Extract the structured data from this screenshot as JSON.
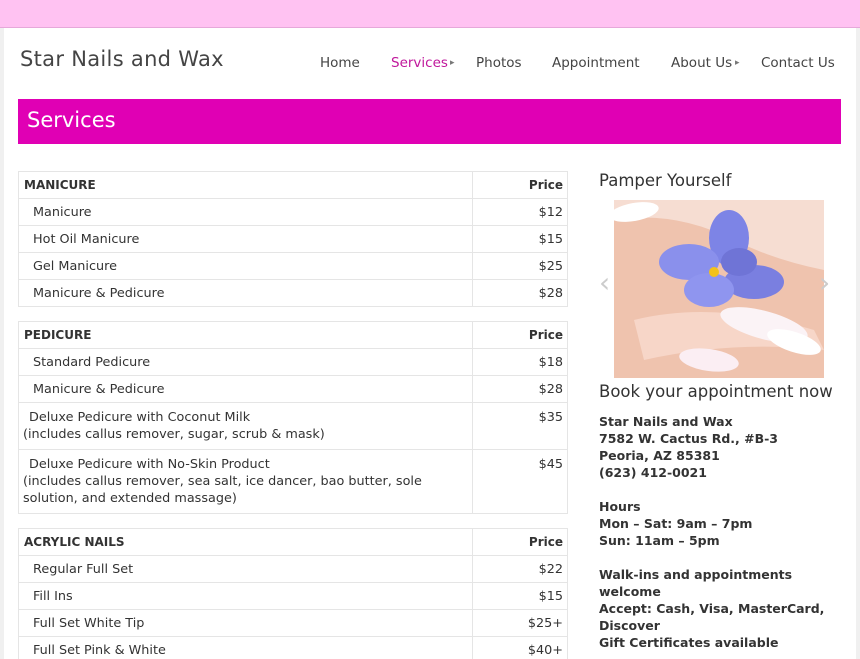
{
  "top_bar": {
    "color": "#ffc2f2"
  },
  "header": {
    "site_title": "Star Nails and Wax"
  },
  "nav": {
    "items": [
      {
        "label": "Home"
      },
      {
        "label": "Services",
        "has_submenu": true,
        "active": true
      },
      {
        "label": "Photos"
      },
      {
        "label": "Appointment"
      },
      {
        "label": "About Us",
        "has_submenu": true
      },
      {
        "label": "Contact Us"
      }
    ],
    "active_color": "#c0179b"
  },
  "banner": {
    "title": "Services",
    "color": "#e000b4"
  },
  "price_header": "Price",
  "sections": [
    {
      "title": "MANICURE",
      "rows": [
        {
          "name": "Manicure",
          "price": "$12"
        },
        {
          "name": "Hot Oil Manicure",
          "price": "$15"
        },
        {
          "name": "Gel Manicure",
          "price": "$25"
        },
        {
          "name": "Manicure & Pedicure",
          "price": "$28"
        }
      ]
    },
    {
      "title": "PEDICURE",
      "rows": [
        {
          "name": "Standard Pedicure",
          "price": "$18"
        },
        {
          "name": "Manicure & Pedicure",
          "price": "$28"
        },
        {
          "name": "Deluxe Pedicure with Coconut Milk",
          "note": "(includes callus remover, sugar, scrub & mask)",
          "price": "$35"
        },
        {
          "name": "Deluxe Pedicure with No-Skin Product",
          "note": "(includes callus remover, sea salt, ice dancer, bao butter, sole solution, and extended massage)",
          "price": "$45"
        }
      ]
    },
    {
      "title": "ACRYLIC NAILS",
      "rows": [
        {
          "name": "Regular Full Set",
          "price": "$22"
        },
        {
          "name": "Fill Ins",
          "price": "$15"
        },
        {
          "name": "Full Set White Tip",
          "price": "$25+"
        },
        {
          "name": "Full Set Pink & White",
          "price": "$40+"
        }
      ]
    }
  ],
  "sidebar": {
    "pamper_heading": "Pamper Yourself",
    "slider": {
      "prev_icon": "chevron-left-icon",
      "next_icon": "chevron-right-icon"
    },
    "book_heading": "Book your appointment now",
    "address": {
      "name": "Star Nails and Wax",
      "street": "7582 W. Cactus Rd., #B-3",
      "city": "Peoria, AZ 85381",
      "phone": "(623) 412-0021"
    },
    "hours": {
      "label": "Hours",
      "weekday": "Mon – Sat: 9am – 7pm",
      "sunday": "Sun: 11am – 5pm"
    },
    "info": {
      "walkins": "Walk-ins and appointments welcome",
      "accept": "Accept: Cash, Visa, MasterCard, Discover",
      "gift": "Gift Certificates available"
    }
  }
}
